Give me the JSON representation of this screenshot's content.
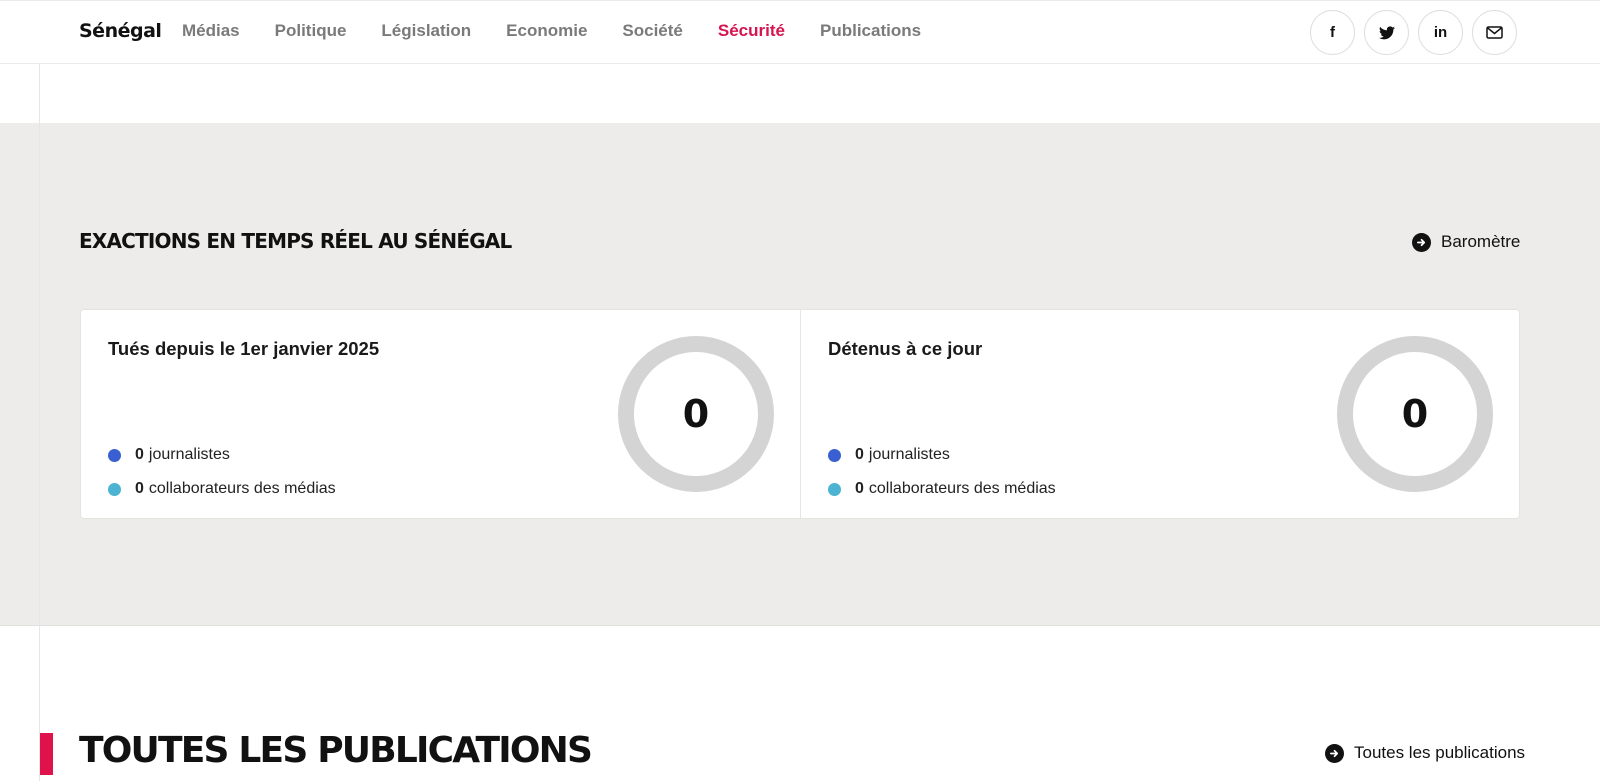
{
  "header": {
    "brand": "Sénégal",
    "nav": [
      {
        "label": "Médias",
        "active": false
      },
      {
        "label": "Politique",
        "active": false
      },
      {
        "label": "Législation",
        "active": false
      },
      {
        "label": "Economie",
        "active": false
      },
      {
        "label": "Société",
        "active": false
      },
      {
        "label": "Sécurité",
        "active": true
      },
      {
        "label": "Publications",
        "active": false
      }
    ],
    "socials": [
      {
        "icon": "facebook-icon",
        "label": "f"
      },
      {
        "icon": "twitter-icon",
        "label": ""
      },
      {
        "icon": "linkedin-icon",
        "label": "in"
      },
      {
        "icon": "mail-icon",
        "label": ""
      }
    ]
  },
  "exactions": {
    "title": "EXACTIONS EN TEMPS RÉEL AU SÉNÉGAL",
    "link_label": "Baromètre",
    "cards": [
      {
        "title": "Tués depuis le 1er janvier 2025",
        "total": "0",
        "rows": [
          {
            "count": "0",
            "label": "journalistes",
            "color": "#3a5fd1"
          },
          {
            "count": "0",
            "label": "collaborateurs des médias",
            "color": "#4cb3d0"
          }
        ]
      },
      {
        "title": "Détenus à ce jour",
        "total": "0",
        "rows": [
          {
            "count": "0",
            "label": "journalistes",
            "color": "#3a5fd1"
          },
          {
            "count": "0",
            "label": "collaborateurs des médias",
            "color": "#4cb3d0"
          }
        ]
      }
    ]
  },
  "publications": {
    "title": "TOUTES LES PUBLICATIONS",
    "link_label": "Toutes les publications"
  },
  "colors": {
    "accent": "#d6144f",
    "band_bg": "#edecea",
    "donut_ring": "#d4d4d4"
  }
}
